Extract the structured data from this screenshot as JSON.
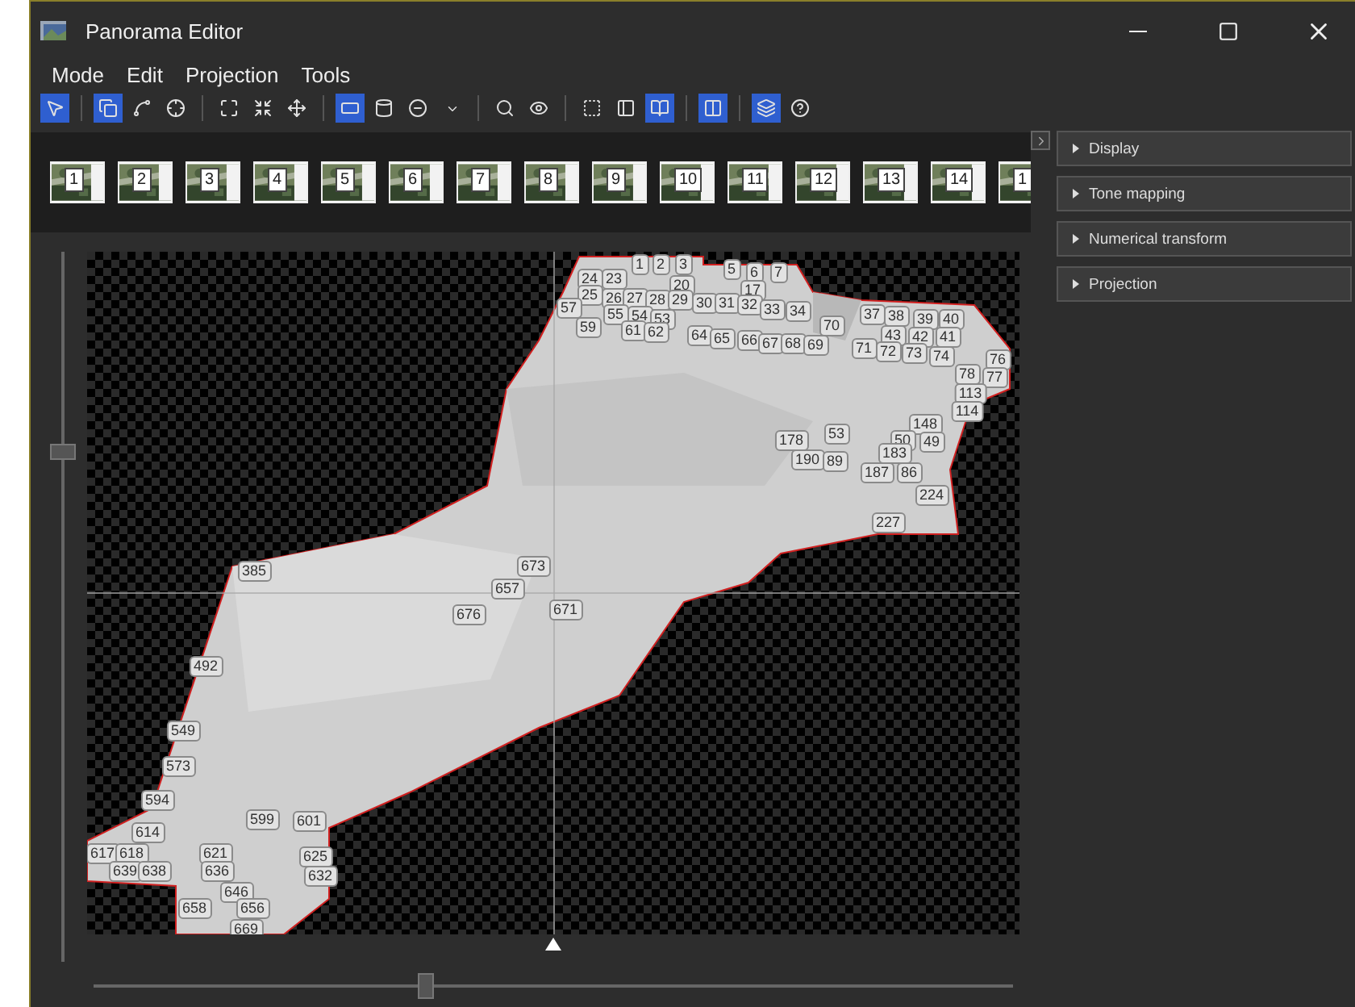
{
  "window": {
    "title": "Panorama Editor"
  },
  "menu": [
    "Mode",
    "Edit",
    "Projection",
    "Tools"
  ],
  "toolbar": [
    {
      "kind": "tool",
      "selected": true
    },
    {
      "kind": "separator"
    },
    {
      "kind": "tool",
      "selected": true
    },
    {
      "kind": "tool",
      "selected": false
    },
    {
      "kind": "tool",
      "selected": false
    },
    {
      "kind": "separator"
    },
    {
      "kind": "tool",
      "selected": false
    },
    {
      "kind": "tool",
      "selected": false
    },
    {
      "kind": "tool",
      "selected": false
    },
    {
      "kind": "separator"
    },
    {
      "kind": "tool",
      "selected": true
    },
    {
      "kind": "tool",
      "selected": false
    },
    {
      "kind": "tool",
      "selected": false
    },
    {
      "kind": "dropdown",
      "selected": false
    },
    {
      "kind": "separator"
    },
    {
      "kind": "tool",
      "selected": false
    },
    {
      "kind": "tool",
      "selected": false
    },
    {
      "kind": "separator"
    },
    {
      "kind": "tool",
      "selected": false
    },
    {
      "kind": "tool",
      "selected": false
    },
    {
      "kind": "tool",
      "selected": true
    },
    {
      "kind": "separator"
    },
    {
      "kind": "tool",
      "selected": true
    },
    {
      "kind": "separator"
    },
    {
      "kind": "tool",
      "selected": true
    },
    {
      "kind": "tool",
      "selected": false
    }
  ],
  "thumbnails": [
    "1",
    "2",
    "3",
    "4",
    "5",
    "6",
    "7",
    "8",
    "9",
    "10",
    "11",
    "12",
    "13",
    "14",
    "1"
  ],
  "panels": [
    {
      "label": "Display",
      "expanded": false
    },
    {
      "label": "Tone mapping",
      "expanded": false
    },
    {
      "label": "Numerical transform",
      "expanded": false
    },
    {
      "label": "Projection",
      "expanded": false
    }
  ],
  "vertical_slider": {
    "level": 0.72
  },
  "horizontal_slider": {
    "level": 0.36
  },
  "tile_labels": [
    "1",
    "2",
    "3",
    "5",
    "6",
    "7",
    "17",
    "24",
    "23",
    "20",
    "25",
    "26",
    "27",
    "28",
    "29",
    "30",
    "31",
    "32",
    "33",
    "34",
    "70",
    "37",
    "38",
    "39",
    "40",
    "43",
    "42",
    "41",
    "57",
    "55",
    "54",
    "53",
    "59",
    "61",
    "62",
    "64",
    "65",
    "66",
    "67",
    "68",
    "69",
    "71",
    "72",
    "73",
    "74",
    "76",
    "78",
    "77",
    "113",
    "114",
    "148",
    "178",
    "53",
    "50",
    "49",
    "183",
    "190",
    "89",
    "187",
    "86",
    "224",
    "227",
    "385",
    "673",
    "657",
    "671",
    "676",
    "492",
    "549",
    "573",
    "594",
    "614",
    "617",
    "618",
    "621",
    "639",
    "638",
    "636",
    "632",
    "625",
    "646",
    "658",
    "656",
    "669",
    "601",
    "599"
  ]
}
